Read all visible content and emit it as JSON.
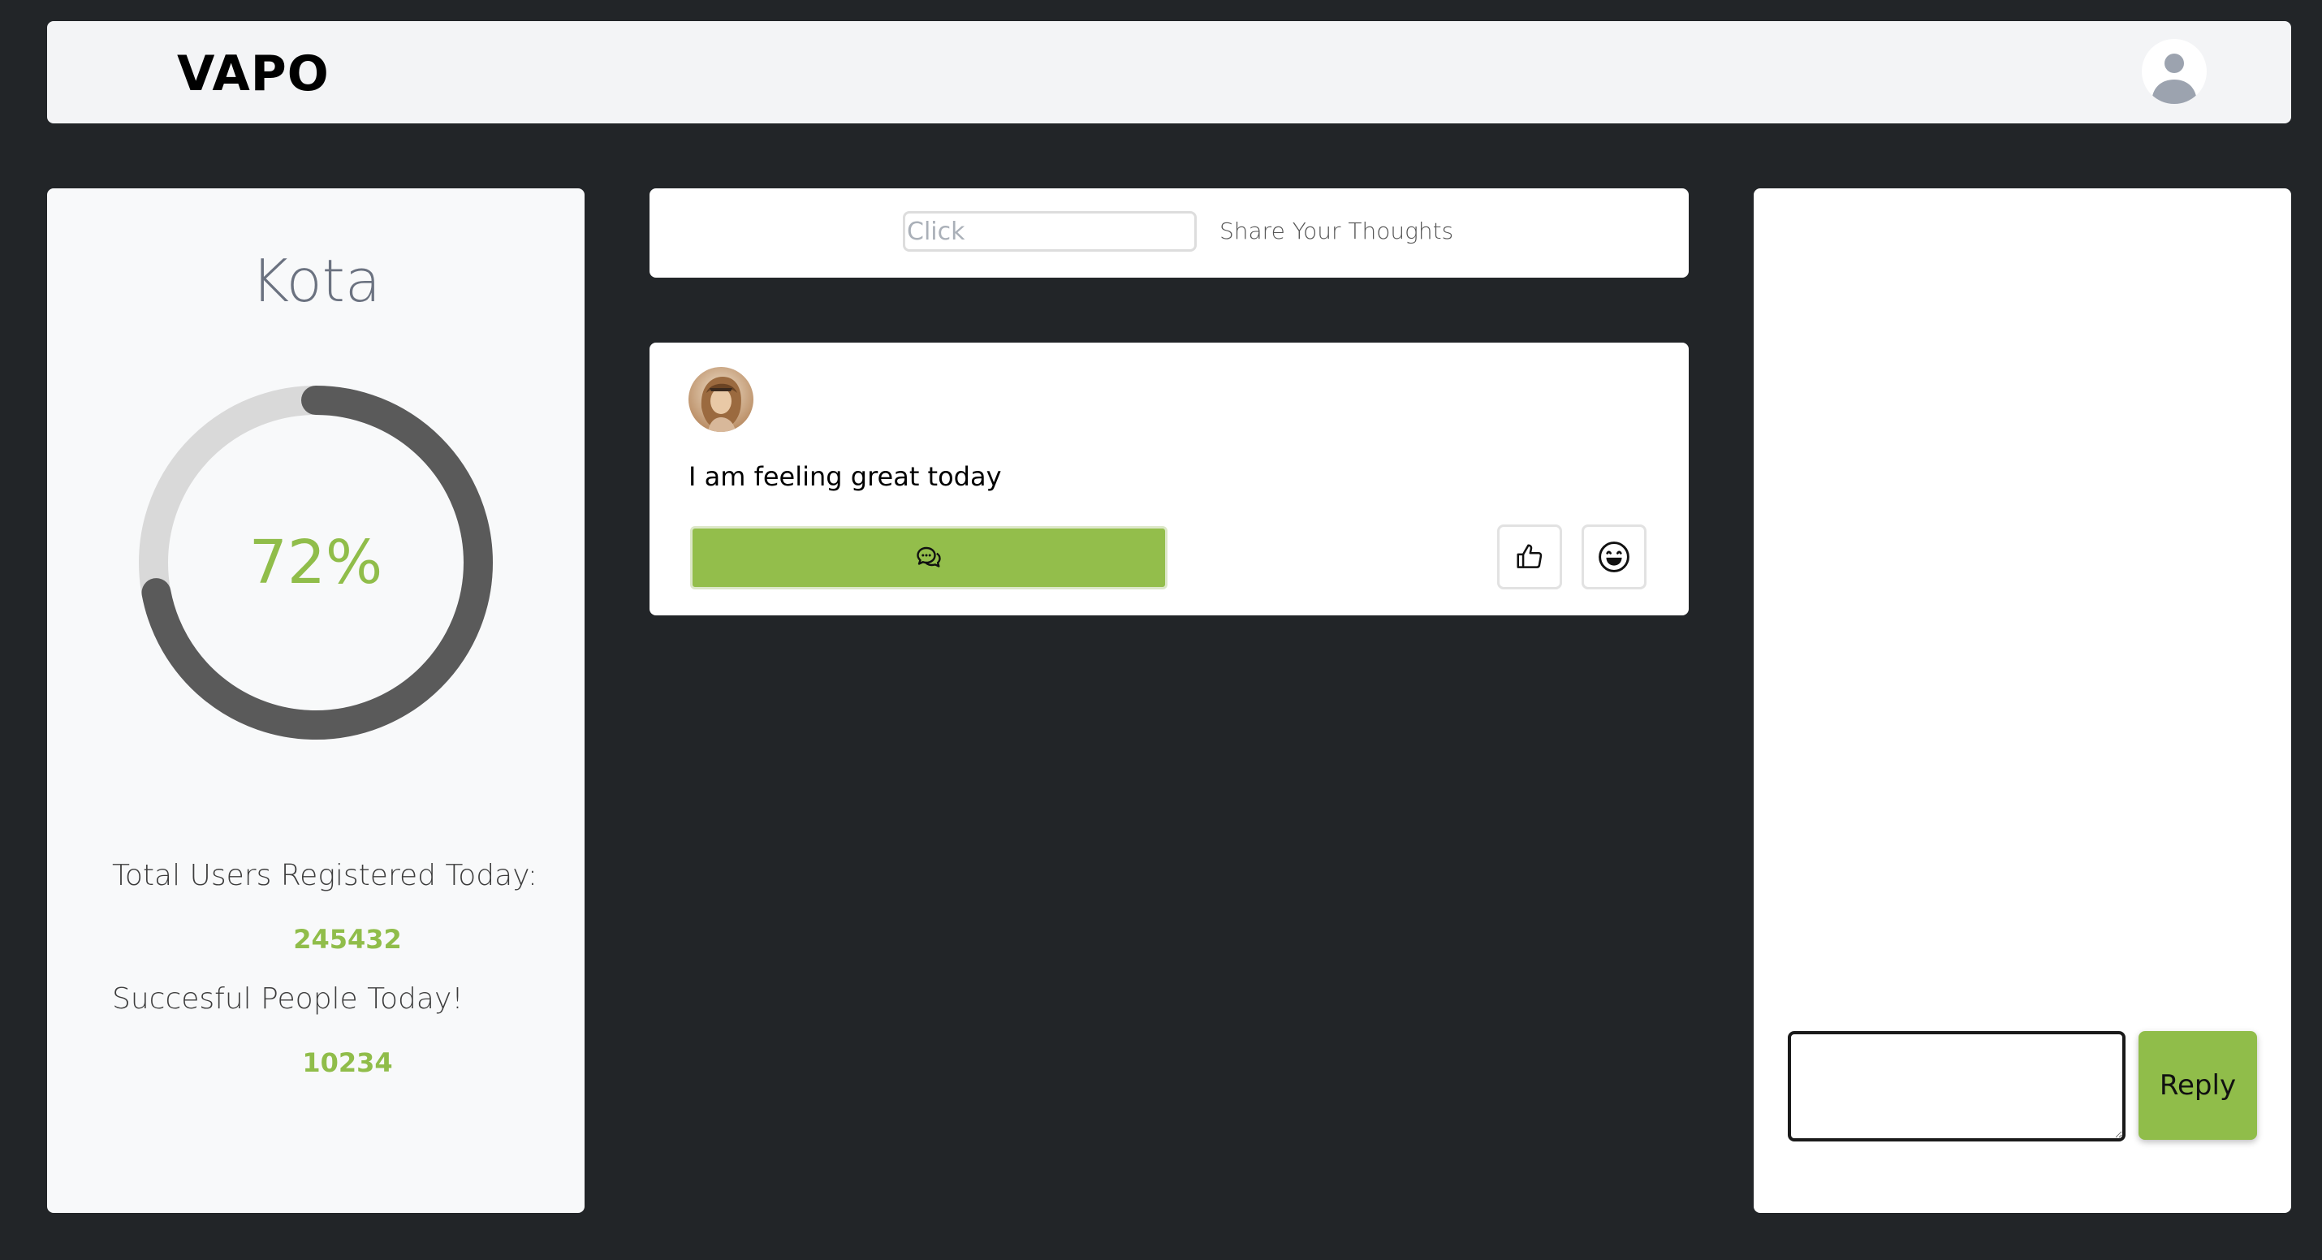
{
  "header": {
    "brand": "VAPO",
    "avatar_icon": "user-avatar-icon"
  },
  "stats": {
    "city": "Kota",
    "progress_percent": 72,
    "progress_label": "72%",
    "total_users_label": "Total Users Registered Today:",
    "total_users_value": "245432",
    "successful_label": "Succesful People Today!",
    "successful_value": "10234"
  },
  "composer": {
    "input_placeholder": "Click",
    "label": "Share Your Thoughts"
  },
  "post": {
    "avatar_icon": "profile-photo",
    "text": "I am feeling great today",
    "comment_icon": "chat-bubbles-icon",
    "like_icon": "thumbs-up-icon",
    "laugh_icon": "laughing-face-icon"
  },
  "reply": {
    "textarea_value": "",
    "button_label": "Reply"
  },
  "colors": {
    "background": "#222528",
    "accent_green": "#90bd4a",
    "ring_track": "#d9d9d9",
    "ring_fill": "#5a5a5a"
  }
}
